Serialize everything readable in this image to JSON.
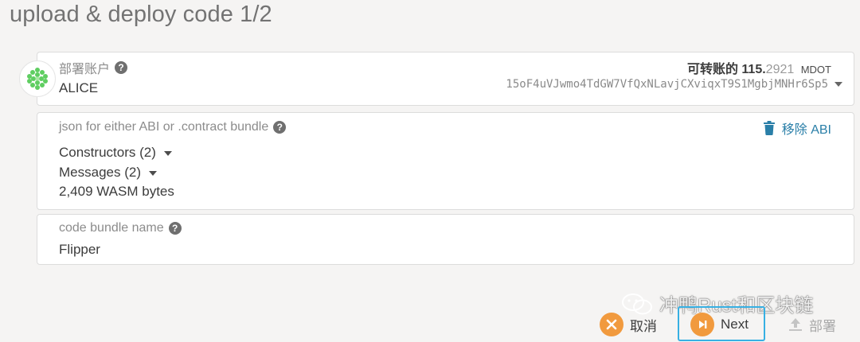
{
  "page": {
    "title": "upload & deploy code 1/2"
  },
  "account": {
    "label": "部署账户",
    "name": "ALICE",
    "balance_label": "可转账的",
    "balance_int": "115.",
    "balance_dec": "2921",
    "balance_unit": "MDOT",
    "address": "15oF4uVJwmo4TdGW7VfQxNLavjCXviqxT9S1MgbjMNHr6Sp5"
  },
  "abi": {
    "label": "json for either ABI or .contract bundle",
    "remove_label": "移除 ABI",
    "constructors": "Constructors (2)",
    "messages": "Messages (2)",
    "wasm_size": "2,409 WASM bytes"
  },
  "bundle": {
    "label": "code bundle name",
    "value": "Flipper"
  },
  "actions": {
    "cancel": "取消",
    "next": "Next",
    "deploy": "部署"
  },
  "watermark": {
    "text": "冲鸭Rust和区块链"
  },
  "colors": {
    "accent": "#f19a3e",
    "link": "#2a7fa8",
    "highlight": "#37b0e3",
    "identicon": "#5fce61"
  },
  "icons": {
    "help": "question-circle-icon",
    "trash": "trash-icon",
    "cancel": "x-circle-icon",
    "next": "play-next-icon",
    "deploy": "upload-icon"
  }
}
